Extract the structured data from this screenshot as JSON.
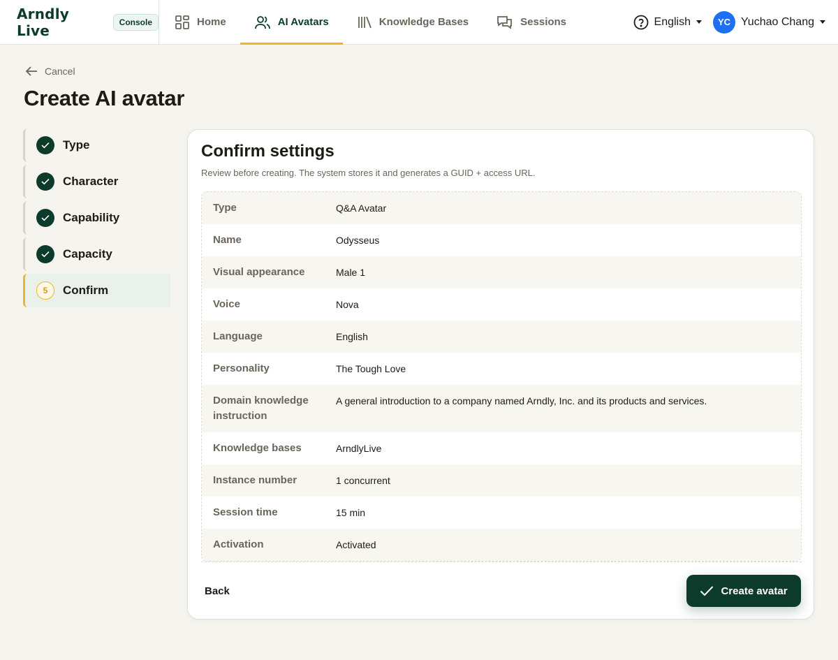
{
  "brand": {
    "logo": "Arndly Live",
    "badge": "Console"
  },
  "nav": {
    "items": [
      {
        "label": "Home",
        "icon": "grid-icon"
      },
      {
        "label": "AI Avatars",
        "icon": "users-icon",
        "active": true
      },
      {
        "label": "Knowledge Bases",
        "icon": "library-icon"
      },
      {
        "label": "Sessions",
        "icon": "chat-icon"
      }
    ],
    "language": "English",
    "user": {
      "initials": "YC",
      "name": "Yuchao Chang"
    }
  },
  "header": {
    "cancel": "Cancel",
    "title": "Create AI avatar"
  },
  "stepper": {
    "steps": [
      {
        "label": "Type",
        "state": "done"
      },
      {
        "label": "Character",
        "state": "done"
      },
      {
        "label": "Capability",
        "state": "done"
      },
      {
        "label": "Capacity",
        "state": "done"
      },
      {
        "label": "Confirm",
        "state": "current",
        "number": "5"
      }
    ]
  },
  "card": {
    "title": "Confirm settings",
    "subtitle": "Review before creating. The system stores it and generates a GUID + access URL.",
    "rows": [
      {
        "key": "Type",
        "value": "Q&A Avatar"
      },
      {
        "key": "Name",
        "value": "Odysseus"
      },
      {
        "key": "Visual appearance",
        "value": "Male 1"
      },
      {
        "key": "Voice",
        "value": "Nova"
      },
      {
        "key": "Language",
        "value": "English"
      },
      {
        "key": "Personality",
        "value": "The Tough Love"
      },
      {
        "key": "Domain knowledge instruction",
        "value": "A general introduction to a company named Arndly, Inc. and its products and services."
      },
      {
        "key": "Knowledge bases",
        "value": "ArndlyLive"
      },
      {
        "key": "Instance number",
        "value": "1 concurrent"
      },
      {
        "key": "Session time",
        "value": "15 min"
      },
      {
        "key": "Activation",
        "value": "Activated"
      }
    ],
    "back": "Back",
    "create": "Create avatar"
  },
  "colors": {
    "brand": "#0c3b2c",
    "accent": "#f0b429",
    "avatar": "#1e6ff1"
  }
}
